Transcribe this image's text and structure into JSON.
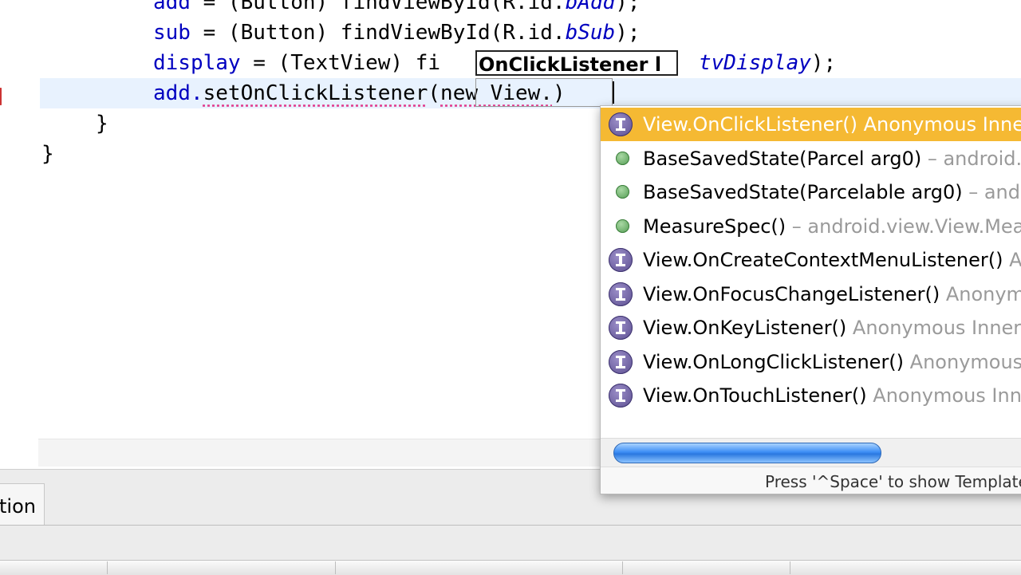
{
  "editor": {
    "lines": [
      {
        "var": "add",
        "op": " = (Button) findViewById(R.id.",
        "id": "bAdd",
        "end": ");"
      },
      {
        "var": "sub",
        "op": " = (Button) findViewById(R.id.",
        "id": "bSub",
        "end": ");"
      },
      {
        "var": "display",
        "op": " = (TextView) fi",
        "id": "tvDisplay",
        "end": ");"
      },
      {
        "pre": "add.",
        "call": "setOnClickListener",
        "arg_open": "(",
        "arg": "new View.",
        "arg_close": ")"
      }
    ],
    "close_inner": "}",
    "close_outer": "}",
    "hover_text": "OnClickListener l"
  },
  "autocomplete": {
    "items": [
      {
        "label": "View.OnClickListener()",
        "desc": "  Anonymous Inner Type",
        "icon": "interface-icon",
        "selected": true
      },
      {
        "label": "BaseSavedState(Parcel arg0)",
        "desc": " – android.view.View.BaseSavedState",
        "icon": "constructor-icon",
        "selected": false
      },
      {
        "label": "BaseSavedState(Parcelable arg0)",
        "desc": " – android.view.View.BaseSavedState",
        "icon": "constructor-icon",
        "selected": false
      },
      {
        "label": "MeasureSpec()",
        "desc": " – android.view.View.MeasureSpec",
        "icon": "constructor-icon",
        "selected": false
      },
      {
        "label": "View.OnCreateContextMenuListener()",
        "desc": "  Anonymous Inner Type",
        "icon": "interface-icon",
        "selected": false
      },
      {
        "label": "View.OnFocusChangeListener()",
        "desc": "  Anonymous Inner Type",
        "icon": "interface-icon",
        "selected": false
      },
      {
        "label": "View.OnKeyListener()",
        "desc": "  Anonymous Inner Type",
        "icon": "interface-icon",
        "selected": false
      },
      {
        "label": "View.OnLongClickListener()",
        "desc": "  Anonymous Inner Type",
        "icon": "interface-icon",
        "selected": false
      },
      {
        "label": "View.OnTouchListener()",
        "desc": "  Anonymous Inner Type",
        "icon": "interface-icon",
        "selected": false
      }
    ],
    "status": "Press '^Space' to show Template Proposals"
  },
  "bottom": {
    "tab_label": "Declaration"
  },
  "colors": {
    "field": "#0000c0",
    "selection": "#f5b933",
    "current_line": "#e8f2fe"
  }
}
